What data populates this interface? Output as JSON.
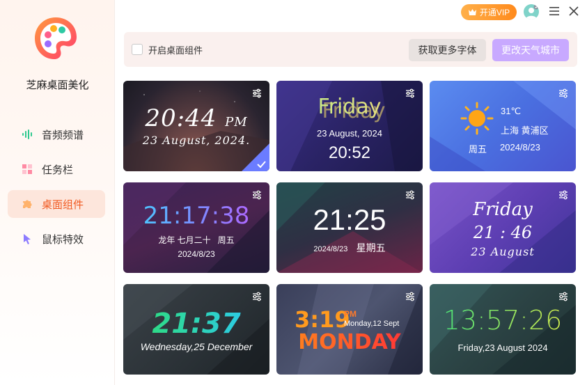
{
  "app": {
    "name": "芝麻桌面美化"
  },
  "sidebar": {
    "items": [
      {
        "label": "音频频谱",
        "icon": "audio-spectrum-icon",
        "active": false
      },
      {
        "label": "任务栏",
        "icon": "taskbar-icon",
        "active": false
      },
      {
        "label": "桌面组件",
        "icon": "puzzle-icon",
        "active": true
      },
      {
        "label": "鼠标特效",
        "icon": "cursor-icon",
        "active": false
      }
    ]
  },
  "titlebar": {
    "vip_label": "开通VIP"
  },
  "toolbar": {
    "enable_widget_label": "开启桌面组件",
    "enable_widget_checked": false,
    "more_fonts_label": "获取更多字体",
    "change_city_label": "更改天气城市"
  },
  "widgets": [
    {
      "time": "20:44",
      "ampm": "PM",
      "date": "23 August, 2024.",
      "selected": true
    },
    {
      "day": "Friday",
      "date": "23 August, 2024",
      "time": "20:52"
    },
    {
      "temp": "31℃",
      "location": "上海 黄浦区",
      "weekday": "周五",
      "date": "2024/8/23"
    },
    {
      "time": "21:17:38",
      "lunar": "龙年 七月二十",
      "weekday": "周五",
      "date": "2024/8/23"
    },
    {
      "time": "21:25",
      "date": "2024/8/23",
      "weekday": "星期五"
    },
    {
      "day": "Friday",
      "time": "21 : 46",
      "date": "23 August"
    },
    {
      "time": "21:37",
      "date": "Wednesday,25 December"
    },
    {
      "time": "3:19",
      "ampm": "PM",
      "date": "Monday,12 Sept",
      "day": "MONDAY"
    },
    {
      "time": "13:57:26",
      "date": "Friday,23 August 2024"
    }
  ],
  "colors": {
    "accent": "#f15a22",
    "active_bg": "#fde6dc",
    "vip_gradient_start": "#ffb04a",
    "vip_gradient_end": "#ff8a1c",
    "city_button": "#c8a9ff"
  }
}
